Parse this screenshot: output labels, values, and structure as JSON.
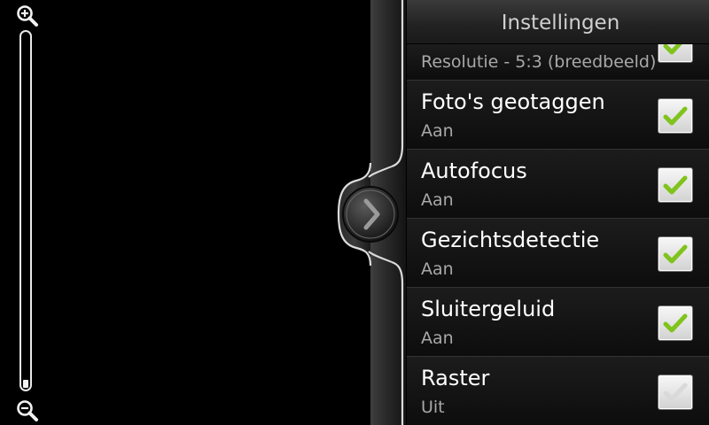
{
  "zoom": {
    "in_icon": "zoom-in-icon",
    "out_icon": "zoom-out-icon",
    "level": 0
  },
  "drawer": {
    "handle_icon": "chevron-right-icon"
  },
  "settings": {
    "title": "Instellingen",
    "items": [
      {
        "title": "",
        "value": "Resolutie - 5:3 (breedbeeld)",
        "checked": true
      },
      {
        "title": "Foto's geotaggen",
        "value": "Aan",
        "checked": true
      },
      {
        "title": "Autofocus",
        "value": "Aan",
        "checked": true
      },
      {
        "title": "Gezichtsdetectie",
        "value": "Aan",
        "checked": true
      },
      {
        "title": "Sluitergeluid",
        "value": "Aan",
        "checked": true
      },
      {
        "title": "Raster",
        "value": "Uit",
        "checked": false
      }
    ]
  },
  "colors": {
    "check_green": "#7fc31c",
    "check_grey": "#d9d9d9",
    "background": "#000000",
    "panel": "#101010"
  }
}
